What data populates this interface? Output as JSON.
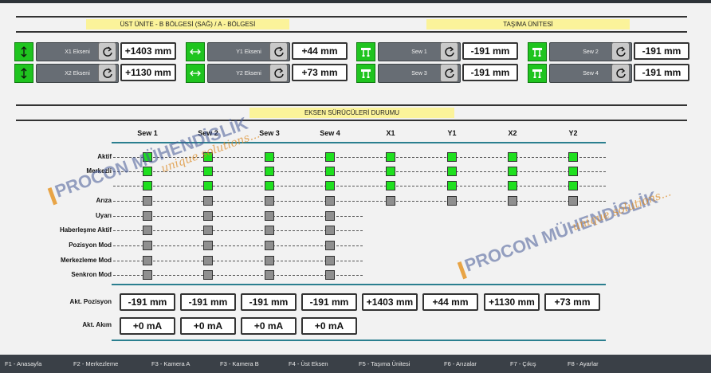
{
  "sections": {
    "left_title": "ÜST ÜNİTE - B BÖLGESİ (SAĞ) / A - BÖLGESİ",
    "right_title": "TAŞIMA ÜNİTESİ",
    "status_title": "EKSEN SÜRÜCÜLERİ DURUMU"
  },
  "axes": [
    {
      "label": "X1 Ekseni",
      "value": "+1403 mm",
      "icon": "vertical-arrows-icon"
    },
    {
      "label": "X2 Ekseni",
      "value": "+1130 mm",
      "icon": "vertical-arrows-icon"
    },
    {
      "label": "Y1 Ekseni",
      "value": "+44 mm",
      "icon": "horizontal-arrows-icon"
    },
    {
      "label": "Y2 Ekseni",
      "value": "+73 mm",
      "icon": "horizontal-arrows-icon"
    },
    {
      "label": "Sew 1",
      "value": "-191 mm",
      "icon": "lift-icon"
    },
    {
      "label": "Sew 3",
      "value": "-191 mm",
      "icon": "lift-icon"
    },
    {
      "label": "Sew 2",
      "value": "-191 mm",
      "icon": "lift-icon"
    },
    {
      "label": "Sew 4",
      "value": "-191 mm",
      "icon": "lift-icon"
    }
  ],
  "status": {
    "columns": [
      "Sew 1",
      "Sew 2",
      "Sew 3",
      "Sew 4",
      "X1",
      "Y1",
      "X2",
      "Y2"
    ],
    "rows": [
      "Aktif",
      "Merkezli",
      "",
      "Arıza",
      "Uyarı",
      "Haberleşme Aktif",
      "Pozisyon Mod",
      "Merkezleme Mod",
      "Senkron Mod"
    ],
    "states": [
      [
        1,
        1,
        1,
        1,
        1,
        1,
        1,
        1
      ],
      [
        1,
        1,
        1,
        1,
        1,
        1,
        1,
        1
      ],
      [
        1,
        1,
        1,
        1,
        1,
        1,
        1,
        1
      ],
      [
        0,
        0,
        0,
        0,
        0,
        0,
        0,
        0
      ],
      [
        0,
        0,
        0,
        0,
        null,
        null,
        null,
        null
      ],
      [
        0,
        0,
        0,
        0,
        null,
        null,
        null,
        null
      ],
      [
        0,
        0,
        0,
        0,
        null,
        null,
        null,
        null
      ],
      [
        0,
        0,
        0,
        0,
        null,
        null,
        null,
        null
      ],
      [
        0,
        0,
        0,
        0,
        null,
        null,
        null,
        null
      ]
    ],
    "on_color": "#1fe01f",
    "off_color": "#8f8f8f"
  },
  "positions": {
    "label": "Akt. Pozisyon",
    "values": [
      "-191 mm",
      "-191 mm",
      "-191 mm",
      "-191 mm",
      "+1403 mm",
      "+44 mm",
      "+1130 mm",
      "+73 mm"
    ]
  },
  "currents": {
    "label": "Akt. Akım",
    "values": [
      "+0 mA",
      "+0 mA",
      "+0 mA",
      "+0 mA"
    ]
  },
  "watermark": {
    "brand": "PROCON MÜHENDİSLİK",
    "slogan": "unique solutions..."
  },
  "footer": [
    "F1 - Anasayfa",
    "F2 - Merkezleme",
    "F3 - Kamera A",
    "F3 - Kamera B",
    "F4 - Üst Eksen",
    "F5 - Taşıma Ünitesi",
    "F6 - Arızalar",
    "F7 - Çıkış",
    "F8 - Ayarlar"
  ]
}
